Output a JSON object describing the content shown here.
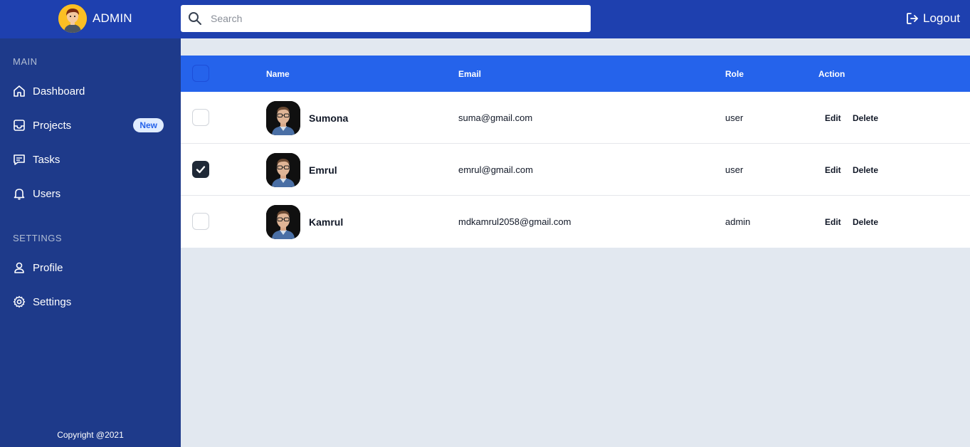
{
  "header": {
    "brand_name": "ADMIN",
    "search_placeholder": "Search",
    "logout_label": "Logout"
  },
  "sidebar": {
    "main_title": "MAIN",
    "main_items": [
      {
        "label": "Dashboard",
        "icon": "home-icon"
      },
      {
        "label": "Projects",
        "icon": "inbox-icon",
        "badge": "New"
      },
      {
        "label": "Tasks",
        "icon": "message-icon"
      },
      {
        "label": "Users",
        "icon": "bell-icon"
      }
    ],
    "settings_title": "SETTINGS",
    "settings_items": [
      {
        "label": "Profile",
        "icon": "user-icon"
      },
      {
        "label": "Settings",
        "icon": "gear-icon"
      }
    ],
    "copyright": "Copyright @2021"
  },
  "table": {
    "columns": [
      "Name",
      "Email",
      "Role",
      "Action"
    ],
    "rows": [
      {
        "name": "Sumona",
        "email": "suma@gmail.com",
        "role": "user",
        "checked": false,
        "edit": "Edit",
        "delete": "Delete"
      },
      {
        "name": "Emrul",
        "email": "emrul@gmail.com",
        "role": "user",
        "checked": true,
        "edit": "Edit",
        "delete": "Delete"
      },
      {
        "name": "Kamrul",
        "email": "mdkamrul2058@gmail.com",
        "role": "admin",
        "checked": false,
        "edit": "Edit",
        "delete": "Delete"
      }
    ]
  },
  "colors": {
    "topbar": "#1e40af",
    "sidebar": "#1e3a8a",
    "table_header": "#2563eb",
    "page_bg": "#e2e8f0"
  }
}
